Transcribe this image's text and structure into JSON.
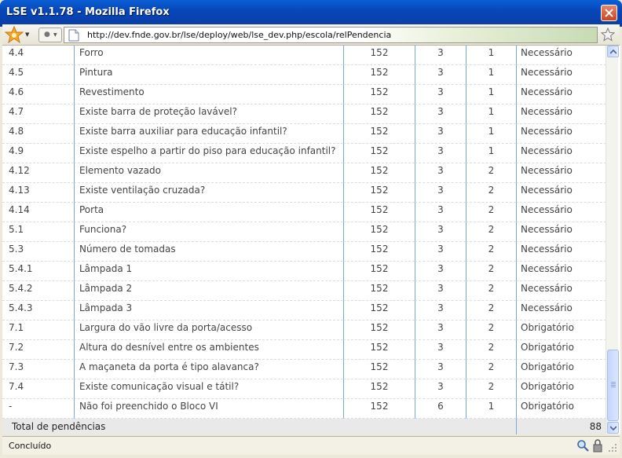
{
  "window": {
    "title": "LSE v1.1.78 - Mozilla Firefox"
  },
  "navbar": {
    "url": "http://dev.fnde.gov.br/lse/deploy/web/lse_dev.php/escola/relPendencia"
  },
  "table": {
    "rows": [
      {
        "code": "4.4",
        "description": "Forro",
        "n1": "152",
        "n2": "3",
        "n3": "1",
        "status": "Necessário"
      },
      {
        "code": "4.5",
        "description": "Pintura",
        "n1": "152",
        "n2": "3",
        "n3": "1",
        "status": "Necessário"
      },
      {
        "code": "4.6",
        "description": "Revestimento",
        "n1": "152",
        "n2": "3",
        "n3": "1",
        "status": "Necessário"
      },
      {
        "code": "4.7",
        "description": "Existe barra de proteção lavável?",
        "n1": "152",
        "n2": "3",
        "n3": "1",
        "status": "Necessário"
      },
      {
        "code": "4.8",
        "description": "Existe barra auxiliar para educação infantil?",
        "n1": "152",
        "n2": "3",
        "n3": "1",
        "status": "Necessário"
      },
      {
        "code": "4.9",
        "description": "Existe espelho a partir do piso para educação infantil?",
        "n1": "152",
        "n2": "3",
        "n3": "1",
        "status": "Necessário"
      },
      {
        "code": "4.12",
        "description": "Elemento vazado",
        "n1": "152",
        "n2": "3",
        "n3": "2",
        "status": "Necessário"
      },
      {
        "code": "4.13",
        "description": "Existe ventilação cruzada?",
        "n1": "152",
        "n2": "3",
        "n3": "2",
        "status": "Necessário"
      },
      {
        "code": "4.14",
        "description": "Porta",
        "n1": "152",
        "n2": "3",
        "n3": "2",
        "status": "Necessário"
      },
      {
        "code": "5.1",
        "description": "Funciona?",
        "n1": "152",
        "n2": "3",
        "n3": "2",
        "status": "Necessário"
      },
      {
        "code": "5.3",
        "description": "Número de tomadas",
        "n1": "152",
        "n2": "3",
        "n3": "2",
        "status": "Necessário"
      },
      {
        "code": "5.4.1",
        "description": "Lâmpada 1",
        "n1": "152",
        "n2": "3",
        "n3": "2",
        "status": "Necessário"
      },
      {
        "code": "5.4.2",
        "description": "Lâmpada 2",
        "n1": "152",
        "n2": "3",
        "n3": "2",
        "status": "Necessário"
      },
      {
        "code": "5.4.3",
        "description": "Lâmpada 3",
        "n1": "152",
        "n2": "3",
        "n3": "2",
        "status": "Necessário"
      },
      {
        "code": "7.1",
        "description": "Largura do vão livre da porta/acesso",
        "n1": "152",
        "n2": "3",
        "n3": "2",
        "status": "Obrigatório"
      },
      {
        "code": "7.2",
        "description": "Altura do desnível entre os ambientes",
        "n1": "152",
        "n2": "3",
        "n3": "2",
        "status": "Obrigatório"
      },
      {
        "code": "7.3",
        "description": "A maçaneta da porta é tipo alavanca?",
        "n1": "152",
        "n2": "3",
        "n3": "2",
        "status": "Obrigatório"
      },
      {
        "code": "7.4",
        "description": "Existe comunicação visual e tátil?",
        "n1": "152",
        "n2": "3",
        "n3": "2",
        "status": "Obrigatório"
      },
      {
        "code": "-",
        "description": "Não foi preenchido o Bloco VI",
        "n1": "152",
        "n2": "6",
        "n3": "1",
        "status": "Obrigatório"
      }
    ],
    "total_label": "Total de pendências",
    "total_value": "88"
  },
  "statusbar": {
    "text": "Concluído"
  },
  "colors": {
    "titlebar": "#0747b8",
    "column_divider": "#7ea7d8",
    "total_row_bg": "#e9e9e9"
  }
}
